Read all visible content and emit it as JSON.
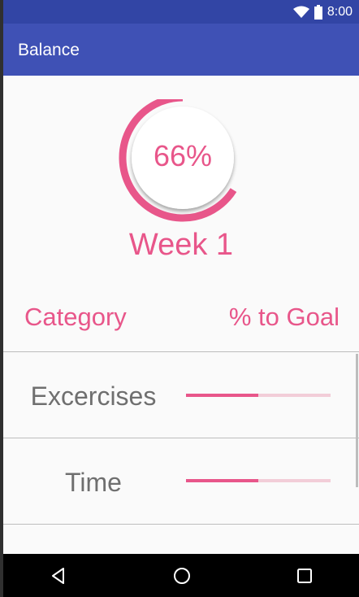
{
  "status_bar": {
    "time": "8:00",
    "icons": [
      "wifi-icon",
      "battery-icon"
    ],
    "color": "#3245a5"
  },
  "app_bar": {
    "title": "Balance",
    "color": "#3f51b5"
  },
  "summary": {
    "progress_percent": 66,
    "progress_label": "66%",
    "week_label": "Week 1",
    "accent_color": "#e8568a"
  },
  "table": {
    "header": {
      "category": "Category",
      "goal": "% to Goal"
    },
    "rows": [
      {
        "label": "Excercises",
        "progress_percent": 50
      },
      {
        "label": "Time",
        "progress_percent": 50
      }
    ]
  },
  "nav_bar": {
    "buttons": [
      "back-icon",
      "home-icon",
      "recents-icon"
    ]
  }
}
